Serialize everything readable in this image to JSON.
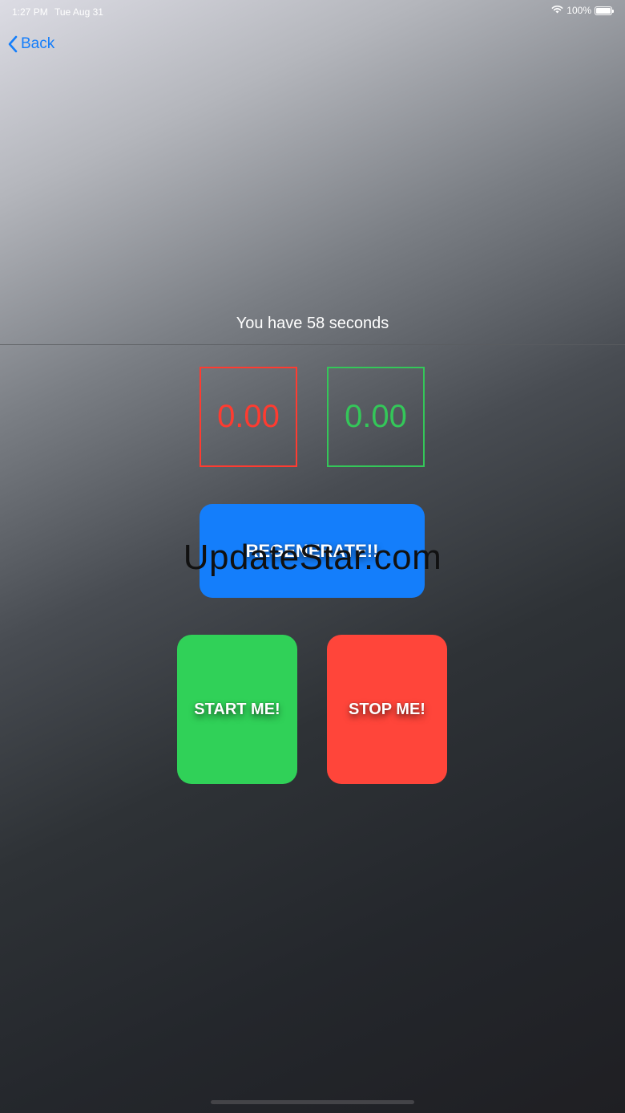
{
  "status_bar": {
    "time": "1:27 PM",
    "date": "Tue Aug 31",
    "battery_percent": "100%",
    "wifi_icon": "wifi-icon",
    "battery_icon": "battery-icon"
  },
  "nav": {
    "back_label": "Back",
    "back_icon": "chevron-left-icon"
  },
  "timer": {
    "text": "You have 58 seconds"
  },
  "values": {
    "red_value": "0.00",
    "green_value": "0.00"
  },
  "buttons": {
    "regenerate_label": "REGENERATE!!",
    "start_label": "START ME!",
    "stop_label": "STOP ME!"
  },
  "watermark": "UpdateStar.com",
  "colors": {
    "accent_blue": "#147efb",
    "red": "#ff3b30",
    "green": "#34c759",
    "start_green": "#30d158",
    "stop_red": "#ff453a"
  }
}
